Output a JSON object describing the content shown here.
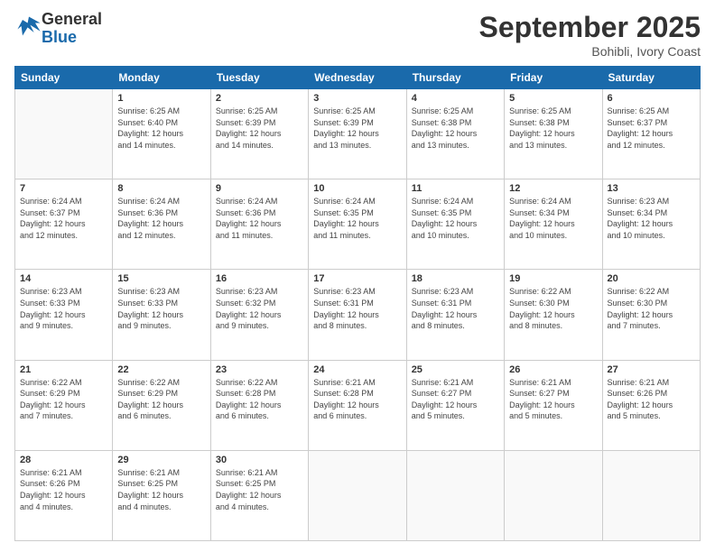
{
  "header": {
    "logo_general": "General",
    "logo_blue": "Blue",
    "month_title": "September 2025",
    "location": "Bohibli, Ivory Coast"
  },
  "days_of_week": [
    "Sunday",
    "Monday",
    "Tuesday",
    "Wednesday",
    "Thursday",
    "Friday",
    "Saturday"
  ],
  "weeks": [
    [
      {
        "day": "",
        "info": ""
      },
      {
        "day": "1",
        "info": "Sunrise: 6:25 AM\nSunset: 6:40 PM\nDaylight: 12 hours\nand 14 minutes."
      },
      {
        "day": "2",
        "info": "Sunrise: 6:25 AM\nSunset: 6:39 PM\nDaylight: 12 hours\nand 14 minutes."
      },
      {
        "day": "3",
        "info": "Sunrise: 6:25 AM\nSunset: 6:39 PM\nDaylight: 12 hours\nand 13 minutes."
      },
      {
        "day": "4",
        "info": "Sunrise: 6:25 AM\nSunset: 6:38 PM\nDaylight: 12 hours\nand 13 minutes."
      },
      {
        "day": "5",
        "info": "Sunrise: 6:25 AM\nSunset: 6:38 PM\nDaylight: 12 hours\nand 13 minutes."
      },
      {
        "day": "6",
        "info": "Sunrise: 6:25 AM\nSunset: 6:37 PM\nDaylight: 12 hours\nand 12 minutes."
      }
    ],
    [
      {
        "day": "7",
        "info": "Sunrise: 6:24 AM\nSunset: 6:37 PM\nDaylight: 12 hours\nand 12 minutes."
      },
      {
        "day": "8",
        "info": "Sunrise: 6:24 AM\nSunset: 6:36 PM\nDaylight: 12 hours\nand 12 minutes."
      },
      {
        "day": "9",
        "info": "Sunrise: 6:24 AM\nSunset: 6:36 PM\nDaylight: 12 hours\nand 11 minutes."
      },
      {
        "day": "10",
        "info": "Sunrise: 6:24 AM\nSunset: 6:35 PM\nDaylight: 12 hours\nand 11 minutes."
      },
      {
        "day": "11",
        "info": "Sunrise: 6:24 AM\nSunset: 6:35 PM\nDaylight: 12 hours\nand 10 minutes."
      },
      {
        "day": "12",
        "info": "Sunrise: 6:24 AM\nSunset: 6:34 PM\nDaylight: 12 hours\nand 10 minutes."
      },
      {
        "day": "13",
        "info": "Sunrise: 6:23 AM\nSunset: 6:34 PM\nDaylight: 12 hours\nand 10 minutes."
      }
    ],
    [
      {
        "day": "14",
        "info": "Sunrise: 6:23 AM\nSunset: 6:33 PM\nDaylight: 12 hours\nand 9 minutes."
      },
      {
        "day": "15",
        "info": "Sunrise: 6:23 AM\nSunset: 6:33 PM\nDaylight: 12 hours\nand 9 minutes."
      },
      {
        "day": "16",
        "info": "Sunrise: 6:23 AM\nSunset: 6:32 PM\nDaylight: 12 hours\nand 9 minutes."
      },
      {
        "day": "17",
        "info": "Sunrise: 6:23 AM\nSunset: 6:31 PM\nDaylight: 12 hours\nand 8 minutes."
      },
      {
        "day": "18",
        "info": "Sunrise: 6:23 AM\nSunset: 6:31 PM\nDaylight: 12 hours\nand 8 minutes."
      },
      {
        "day": "19",
        "info": "Sunrise: 6:22 AM\nSunset: 6:30 PM\nDaylight: 12 hours\nand 8 minutes."
      },
      {
        "day": "20",
        "info": "Sunrise: 6:22 AM\nSunset: 6:30 PM\nDaylight: 12 hours\nand 7 minutes."
      }
    ],
    [
      {
        "day": "21",
        "info": "Sunrise: 6:22 AM\nSunset: 6:29 PM\nDaylight: 12 hours\nand 7 minutes."
      },
      {
        "day": "22",
        "info": "Sunrise: 6:22 AM\nSunset: 6:29 PM\nDaylight: 12 hours\nand 6 minutes."
      },
      {
        "day": "23",
        "info": "Sunrise: 6:22 AM\nSunset: 6:28 PM\nDaylight: 12 hours\nand 6 minutes."
      },
      {
        "day": "24",
        "info": "Sunrise: 6:21 AM\nSunset: 6:28 PM\nDaylight: 12 hours\nand 6 minutes."
      },
      {
        "day": "25",
        "info": "Sunrise: 6:21 AM\nSunset: 6:27 PM\nDaylight: 12 hours\nand 5 minutes."
      },
      {
        "day": "26",
        "info": "Sunrise: 6:21 AM\nSunset: 6:27 PM\nDaylight: 12 hours\nand 5 minutes."
      },
      {
        "day": "27",
        "info": "Sunrise: 6:21 AM\nSunset: 6:26 PM\nDaylight: 12 hours\nand 5 minutes."
      }
    ],
    [
      {
        "day": "28",
        "info": "Sunrise: 6:21 AM\nSunset: 6:26 PM\nDaylight: 12 hours\nand 4 minutes."
      },
      {
        "day": "29",
        "info": "Sunrise: 6:21 AM\nSunset: 6:25 PM\nDaylight: 12 hours\nand 4 minutes."
      },
      {
        "day": "30",
        "info": "Sunrise: 6:21 AM\nSunset: 6:25 PM\nDaylight: 12 hours\nand 4 minutes."
      },
      {
        "day": "",
        "info": ""
      },
      {
        "day": "",
        "info": ""
      },
      {
        "day": "",
        "info": ""
      },
      {
        "day": "",
        "info": ""
      }
    ]
  ]
}
